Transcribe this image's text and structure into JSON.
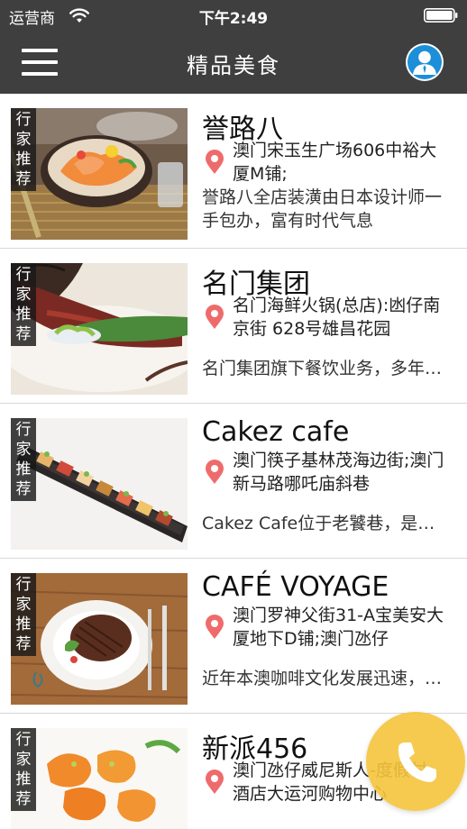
{
  "status_bar": {
    "carrier": "运营商",
    "time": "下午2:49"
  },
  "nav": {
    "title": "精品美食"
  },
  "badge": [
    "行",
    "家",
    "推",
    "荐"
  ],
  "restaurants": [
    {
      "name": "誉路八",
      "address": "澳门宋玉生广场606中裕大厦M铺;",
      "description": "誉路八全店装潢由日本设计师一手包办，富有时代气息"
    },
    {
      "name": "名门集团",
      "address": "名门海鲜火锅(总店):凼仔南京街 628号雄昌花园",
      "description": "名门集团旗下餐饮业务，多年来一直深受欢迎"
    },
    {
      "name": "Cakez  cafe",
      "address": "澳门筷子基林茂海边街;澳门新马路哪吒庙斜巷",
      "description": "Cakez Cafe位于老饕巷，是一间甜品小店"
    },
    {
      "name": "CAFÉ  VOYAGE",
      "address": "澳门罗神父街31-A宝美安大厦地下D铺;澳门氹仔",
      "description": "近年本澳咖啡文化发展迅速，咖啡店林立"
    },
    {
      "name": "新派456",
      "address": "澳门氹仔威尼斯人-度假村-酒店大运河购物中心",
      "description": ""
    }
  ],
  "icons": {
    "menu": "hamburger-icon",
    "avatar": "user-avatar-icon",
    "location": "map-pin-icon",
    "call": "phone-icon",
    "wifi": "wifi-icon",
    "battery": "battery-icon"
  },
  "colors": {
    "nav_bg": "#3f3f3f",
    "pin": "#ef6b6b",
    "call_button": "#f5c43c",
    "avatar_blue": "#1c8fd8"
  }
}
